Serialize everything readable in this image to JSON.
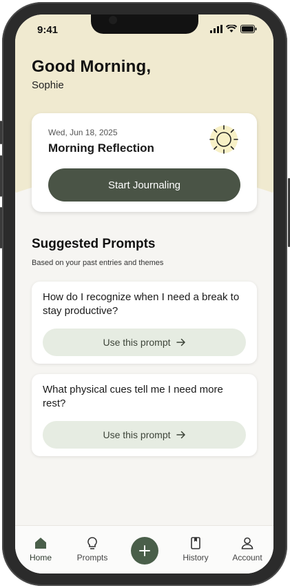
{
  "status": {
    "time": "9:41"
  },
  "header": {
    "greeting": "Good Morning,",
    "name": "Sophie"
  },
  "reflection_card": {
    "date": "Wed, Jun 18, 2025",
    "title": "Morning Reflection",
    "cta_label": "Start Journaling",
    "icon": "sun-icon"
  },
  "suggested": {
    "title": "Suggested Prompts",
    "subtitle": "Based on your past entries and themes",
    "prompts": [
      {
        "text": "How do I recognize when I need a break to stay productive?",
        "button_label": "Use this prompt"
      },
      {
        "text": "What physical cues tell me I need more rest?",
        "button_label": "Use this prompt"
      }
    ]
  },
  "tabbar": {
    "items": [
      {
        "label": "Home",
        "icon": "home-icon"
      },
      {
        "label": "Prompts",
        "icon": "lightbulb-icon"
      },
      {
        "label": "History",
        "icon": "book-icon"
      },
      {
        "label": "Account",
        "icon": "person-icon"
      }
    ],
    "fab_icon": "plus-icon"
  },
  "colors": {
    "accent": "#4a5446",
    "hero": "#f0ead0",
    "prompt_button": "#e6ece2",
    "background": "#f6f5f2"
  }
}
